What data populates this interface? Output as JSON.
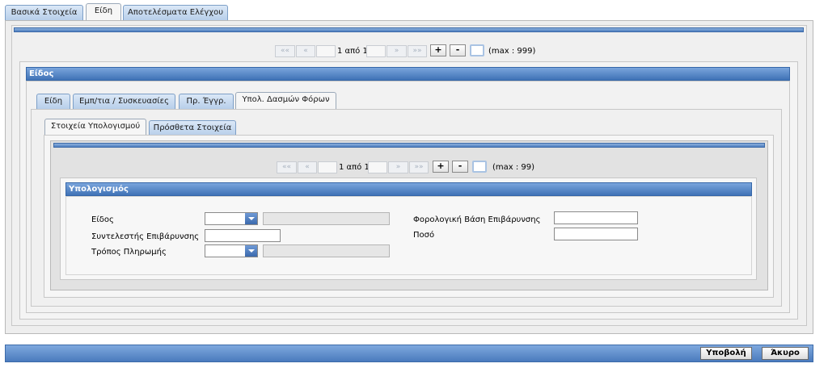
{
  "main_tabs": [
    {
      "label": "Βασικά Στοιχεία",
      "active": false
    },
    {
      "label": "Είδη",
      "active": true
    },
    {
      "label": "Αποτελέσματα Ελέγχου",
      "active": false
    }
  ],
  "outer_pager": {
    "first": "«« ",
    "prev": "«",
    "page_text": "1 από 1",
    "next": "»",
    "last": "»»",
    "add": "+",
    "remove": "-",
    "max_text": "(max : 999)"
  },
  "eidos_section": {
    "title": "Είδος",
    "tabs": [
      {
        "label": "Είδη",
        "active": false
      },
      {
        "label": "Εμπ/τια / Συσκευασίες",
        "active": false
      },
      {
        "label": "Πρ. Έγγρ.",
        "active": false
      },
      {
        "label": "Υπολ. Δασμών Φόρων",
        "active": true
      }
    ]
  },
  "calc_tabs": [
    {
      "label": "Στοιχεία Υπολογισμού",
      "active": true
    },
    {
      "label": "Πρόσθετα Στοιχεία",
      "active": false
    }
  ],
  "inner_pager": {
    "first": "««",
    "prev": "«",
    "page_text": "1 από 1",
    "next": "»",
    "last": "»»",
    "add": "+",
    "remove": "-",
    "max_text": "(max : 99)"
  },
  "calc_section": {
    "title": "Υπολογισμός",
    "fields": {
      "eidos_label": "Είδος",
      "eidos_value": "",
      "syntelestis_label": "Συντελεστής Επιβάρυνσης",
      "syntelestis_value": "",
      "tropos_label": "Τρόπος Πληρωμής",
      "tropos_value": "",
      "forologiki_label": "Φορολογική Βάση Επιβάρυνσης",
      "forologiki_value": "",
      "poso_label": "Ποσό",
      "poso_value": ""
    }
  },
  "footer": {
    "submit": "Υποβολή",
    "cancel": "Άκυρο"
  },
  "colors": {
    "header_blue": "#3f72b6",
    "tab_blue": "#b5cde9",
    "panel_gray": "#eeeeee"
  }
}
